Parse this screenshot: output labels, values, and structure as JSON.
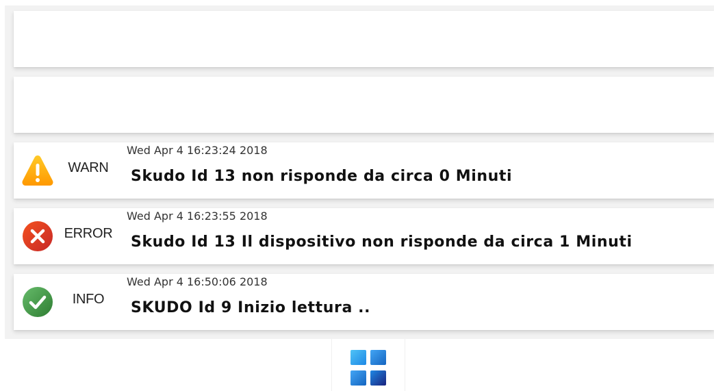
{
  "notifications": [
    {
      "level": "WARN",
      "timestamp": "Wed Apr 4 16:23:24 2018",
      "message": "Skudo Id 13 non risponde da circa 0 Minuti",
      "icon": "warning-icon",
      "color": "#f9a825"
    },
    {
      "level": "ERROR",
      "timestamp": "Wed Apr 4 16:23:55 2018",
      "message": "Skudo Id 13 Il dispositivo non risponde da circa 1 Minuti",
      "icon": "error-icon",
      "color": "#e53935"
    },
    {
      "level": "INFO",
      "timestamp": "Wed Apr 4 16:50:06 2018",
      "message": "SKUDO Id 9 Inizio lettura ..",
      "icon": "check-icon",
      "color": "#43a047"
    }
  ],
  "bottom_nav": {
    "icon": "apps-grid-icon"
  }
}
